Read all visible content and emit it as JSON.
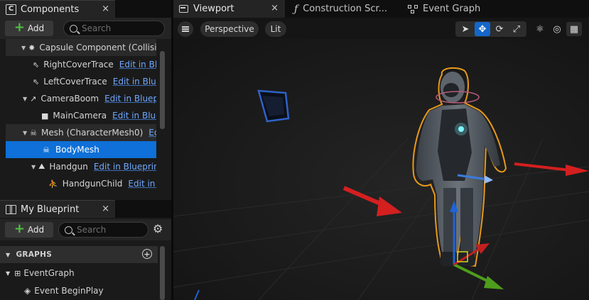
{
  "components_panel": {
    "title": "Components",
    "close": "×",
    "add_label": "Add",
    "search_placeholder": "Search",
    "tree": [
      {
        "label": "Capsule Component (Collision)",
        "link": "",
        "icon": "capsule-icon"
      },
      {
        "label": "RightCoverTrace",
        "link": "Edit in Blueprint",
        "icon": "arrow-component-icon"
      },
      {
        "label": "LeftCoverTrace",
        "link": "Edit in Blueprint",
        "icon": "arrow-component-icon"
      },
      {
        "label": "CameraBoom",
        "link": "Edit in Blueprint",
        "icon": "spring-arm-icon"
      },
      {
        "label": "MainCamera",
        "link": "Edit in Blueprint",
        "icon": "camera-icon"
      },
      {
        "label": "Mesh (CharacterMesh0)",
        "link": "Edit in Blueprint",
        "icon": "skeleton-icon"
      },
      {
        "label": "BodyMesh",
        "link": "",
        "icon": "skeleton-icon"
      },
      {
        "label": "Handgun",
        "link": "Edit in Blueprint",
        "icon": "static-mesh-icon"
      },
      {
        "label": "HandgunChild",
        "link": "Edit in Blueprint",
        "icon": "child-actor-icon"
      }
    ]
  },
  "blueprint_panel": {
    "title": "My Blueprint",
    "close": "×",
    "add_label": "Add",
    "search_placeholder": "Search",
    "section": "GRAPHS",
    "items": [
      {
        "label": "EventGraph"
      },
      {
        "label": "Event BeginPlay"
      }
    ]
  },
  "document_tabs": [
    {
      "label": "Viewport",
      "active": true,
      "close": "×"
    },
    {
      "label": "Construction Scr...",
      "active": false
    },
    {
      "label": "Event Graph",
      "active": false
    }
  ],
  "viewport_toolbar": {
    "view_mode": "Perspective",
    "lighting": "Lit"
  },
  "colors": {
    "selection": "#0e70d8",
    "link": "#6fa8ff",
    "selection_outline": "#e89a1a",
    "axis_x": "#d41f1f",
    "axis_y": "#4e9d1c",
    "axis_z": "#1e63d8"
  }
}
